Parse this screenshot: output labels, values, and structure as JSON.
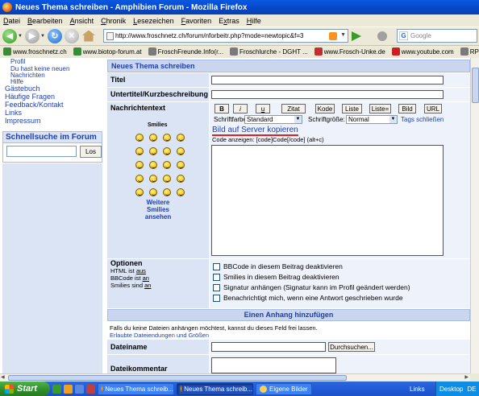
{
  "window": {
    "title": "Neues Thema schreiben - Amphibien Forum - Mozilla Firefox"
  },
  "menu": [
    {
      "pre": "",
      "u": "D",
      "post": "atei"
    },
    {
      "pre": "",
      "u": "B",
      "post": "earbeiten"
    },
    {
      "pre": "",
      "u": "A",
      "post": "nsicht"
    },
    {
      "pre": "",
      "u": "C",
      "post": "hronik"
    },
    {
      "pre": "",
      "u": "L",
      "post": "esezeichen"
    },
    {
      "pre": "",
      "u": "F",
      "post": "avoriten"
    },
    {
      "pre": "E",
      "u": "x",
      "post": "tras"
    },
    {
      "pre": "",
      "u": "H",
      "post": "ilfe"
    }
  ],
  "nav": {
    "url": "http://www.froschnetz.ch/forum/nforbeitr.php?mode=newtopic&f=3",
    "search_placeholder": "Google"
  },
  "bookmarks": [
    {
      "label": "www.froschnetz.ch",
      "color": "#3a8a3a"
    },
    {
      "label": "www.biotop-forum.at",
      "color": "#3a8a3a"
    },
    {
      "label": "FroschFreunde.Info(r...",
      "color": "#7a7a7a"
    },
    {
      "label": "Froschlurche - DGHT ...",
      "color": "#7a7a7a"
    },
    {
      "label": "www.Frosch-Unke.de",
      "color": "#c03030"
    },
    {
      "label": "www.youtube.com",
      "color": "#cc2020"
    },
    {
      "label": "RPG-Atelier - Eure",
      "color": "#7a7a7a"
    }
  ],
  "sidebar": {
    "links": [
      {
        "label": "Profil",
        "sub": true
      },
      {
        "label": "Du hast keine neuen",
        "sub": true
      },
      {
        "label": "Nachrichten",
        "sub": true
      },
      {
        "label": "Hilfe",
        "sub": true
      },
      {
        "label": "Gästebuch",
        "sub": false
      },
      {
        "label": "Häufige Fragen",
        "sub": false
      },
      {
        "label": "Feedback/Kontakt",
        "sub": false
      },
      {
        "label": "Links",
        "sub": false
      },
      {
        "label": "Impressum",
        "sub": false
      }
    ],
    "quicksearch_title": "Schnellsuche im Forum",
    "quicksearch_button": "Los"
  },
  "form": {
    "header": "Neues Thema schreiben",
    "title_label": "Titel",
    "subtitle_label": "Untertitel/Kurzbeschreibung",
    "body_label": "Nachrichtentext",
    "format_buttons": [
      "B",
      "i",
      "u",
      "Zitat",
      "Kode",
      "Liste",
      "Liste=",
      "Bild",
      "URL"
    ],
    "font_color_label": "Schriftfarbe:",
    "font_color_value": "Standard",
    "font_size_label": "Schriftgröße:",
    "font_size_value": "Normal",
    "tags_close": "Tags schließen",
    "upload_image_link": "Bild auf Server kopieren",
    "code_hint": "Code anzeigen: [code]Code[/code] (alt+c)",
    "smilies_label": "Smilies",
    "more_smilies": [
      "Weitere",
      "Smilies",
      "ansehen"
    ],
    "options": {
      "title": "Optionen",
      "html": {
        "pre": "HTML ist ",
        "state": "aus"
      },
      "bbcode": {
        "pre": "BBCode ist ",
        "state": "an"
      },
      "smilies": {
        "pre": "Smilies sind ",
        "state": "an"
      }
    },
    "checkboxes": [
      "BBCode in diesem Beitrag deaktivieren",
      "Smilies in diesem Beitrag deaktivieren",
      "Signatur anhängen (Signatur kann im Profil geändert werden)",
      "Benachrichtigt mich, wenn eine Antwort geschrieben wurde"
    ],
    "attachment": {
      "header": "Einen Anhang hinzufügen",
      "info": "Falls du keine Dateien anhängen möchtest, kannst du dieses Feld frei lassen.",
      "allowed_link": "Erlaubte Dateiendungen und Größen",
      "filename_label": "Dateiname",
      "browse_button": "Durchsuchen...",
      "comment_label": "Dateikommentar"
    }
  },
  "taskbar": {
    "start": "Start",
    "tasks": [
      {
        "label": "Neues Thema schreib...",
        "active": false
      },
      {
        "label": "Neues Thema schreib...",
        "active": true
      },
      {
        "label": "Eigene Bilder",
        "active": false
      }
    ],
    "links_label": "Links",
    "desktop_label": "Desktop",
    "tray_label": "DE"
  }
}
